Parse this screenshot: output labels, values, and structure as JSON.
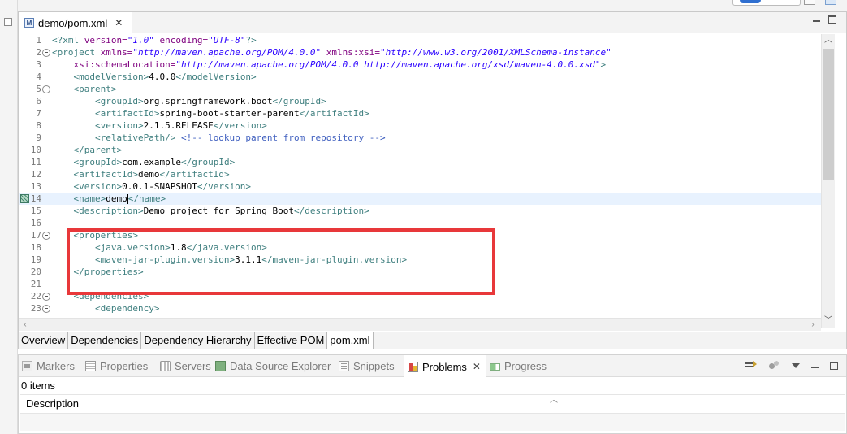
{
  "editor": {
    "tab_title": "demo/pom.xml",
    "tab_icon_letter": "M",
    "close_glyph": "✕",
    "lines": [
      {
        "n": "1",
        "fold": false,
        "current": false,
        "tokens": [
          [
            "pi",
            "<?xml "
          ],
          [
            "attr",
            "version="
          ],
          [
            "str",
            "\"1.0\""
          ],
          [
            "pi",
            " "
          ],
          [
            "attr",
            "encoding="
          ],
          [
            "str",
            "\"UTF-8\""
          ],
          [
            "pi",
            "?>"
          ]
        ]
      },
      {
        "n": "2",
        "fold": true,
        "current": false,
        "tokens": [
          [
            "tag",
            "<project "
          ],
          [
            "attr",
            "xmlns="
          ],
          [
            "str",
            "\"http://maven.apache.org/POM/4.0.0\""
          ],
          [
            "tag",
            " "
          ],
          [
            "attr",
            "xmlns:xsi="
          ],
          [
            "str",
            "\"http://www.w3.org/2001/XMLSchema-instance\""
          ]
        ]
      },
      {
        "n": "3",
        "fold": false,
        "current": false,
        "tokens": [
          [
            "txt",
            "    "
          ],
          [
            "attr",
            "xsi:schemaLocation="
          ],
          [
            "str",
            "\"http://maven.apache.org/POM/4.0.0 http://maven.apache.org/xsd/maven-4.0.0.xsd\""
          ],
          [
            "tag",
            ">"
          ]
        ]
      },
      {
        "n": "4",
        "fold": false,
        "current": false,
        "tokens": [
          [
            "txt",
            "    "
          ],
          [
            "tag",
            "<modelVersion>"
          ],
          [
            "txt",
            "4.0.0"
          ],
          [
            "tag",
            "</modelVersion>"
          ]
        ]
      },
      {
        "n": "5",
        "fold": true,
        "current": false,
        "tokens": [
          [
            "txt",
            "    "
          ],
          [
            "tag",
            "<parent>"
          ]
        ]
      },
      {
        "n": "6",
        "fold": false,
        "current": false,
        "tokens": [
          [
            "txt",
            "        "
          ],
          [
            "tag",
            "<groupId>"
          ],
          [
            "txt",
            "org.springframework.boot"
          ],
          [
            "tag",
            "</groupId>"
          ]
        ]
      },
      {
        "n": "7",
        "fold": false,
        "current": false,
        "tokens": [
          [
            "txt",
            "        "
          ],
          [
            "tag",
            "<artifactId>"
          ],
          [
            "txt",
            "spring-boot-starter-parent"
          ],
          [
            "tag",
            "</artifactId>"
          ]
        ]
      },
      {
        "n": "8",
        "fold": false,
        "current": false,
        "tokens": [
          [
            "txt",
            "        "
          ],
          [
            "tag",
            "<version>"
          ],
          [
            "txt",
            "2.1.5.RELEASE"
          ],
          [
            "tag",
            "</version>"
          ]
        ]
      },
      {
        "n": "9",
        "fold": false,
        "current": false,
        "tokens": [
          [
            "txt",
            "        "
          ],
          [
            "tag",
            "<relativePath/>"
          ],
          [
            "txt",
            " "
          ],
          [
            "cmt",
            "<!-- lookup parent from repository -->"
          ]
        ]
      },
      {
        "n": "10",
        "fold": false,
        "current": false,
        "tokens": [
          [
            "txt",
            "    "
          ],
          [
            "tag",
            "</parent>"
          ]
        ]
      },
      {
        "n": "11",
        "fold": false,
        "current": false,
        "tokens": [
          [
            "txt",
            "    "
          ],
          [
            "tag",
            "<groupId>"
          ],
          [
            "txt",
            "com.example"
          ],
          [
            "tag",
            "</groupId>"
          ]
        ]
      },
      {
        "n": "12",
        "fold": false,
        "current": false,
        "tokens": [
          [
            "txt",
            "    "
          ],
          [
            "tag",
            "<artifactId>"
          ],
          [
            "txt",
            "demo"
          ],
          [
            "tag",
            "</artifactId>"
          ]
        ]
      },
      {
        "n": "13",
        "fold": false,
        "current": false,
        "tokens": [
          [
            "txt",
            "    "
          ],
          [
            "tag",
            "<version>"
          ],
          [
            "txt",
            "0.0.1-SNAPSHOT"
          ],
          [
            "tag",
            "</version>"
          ]
        ]
      },
      {
        "n": "14",
        "fold": false,
        "current": true,
        "tokens": [
          [
            "txt",
            "    "
          ],
          [
            "tag",
            "<name>"
          ],
          [
            "txt",
            "demo"
          ],
          [
            "cursor",
            ""
          ],
          [
            "tag",
            "</name>"
          ]
        ]
      },
      {
        "n": "15",
        "fold": false,
        "current": false,
        "tokens": [
          [
            "txt",
            "    "
          ],
          [
            "tag",
            "<description>"
          ],
          [
            "txt",
            "Demo project for Spring Boot"
          ],
          [
            "tag",
            "</description>"
          ]
        ]
      },
      {
        "n": "16",
        "fold": false,
        "current": false,
        "tokens": []
      },
      {
        "n": "17",
        "fold": true,
        "current": false,
        "tokens": [
          [
            "txt",
            "    "
          ],
          [
            "tag",
            "<properties>"
          ]
        ]
      },
      {
        "n": "18",
        "fold": false,
        "current": false,
        "tokens": [
          [
            "txt",
            "        "
          ],
          [
            "tag",
            "<java.version>"
          ],
          [
            "txt",
            "1.8"
          ],
          [
            "tag",
            "</java.version>"
          ]
        ]
      },
      {
        "n": "19",
        "fold": false,
        "current": false,
        "tokens": [
          [
            "txt",
            "        "
          ],
          [
            "tag",
            "<maven-jar-plugin.version>"
          ],
          [
            "txt",
            "3.1.1"
          ],
          [
            "tag",
            "</maven-jar-plugin.version>"
          ]
        ]
      },
      {
        "n": "20",
        "fold": false,
        "current": false,
        "tokens": [
          [
            "txt",
            "    "
          ],
          [
            "tag",
            "</properties>"
          ]
        ]
      },
      {
        "n": "21",
        "fold": false,
        "current": false,
        "tokens": []
      },
      {
        "n": "22",
        "fold": true,
        "current": false,
        "tokens": [
          [
            "txt",
            "    "
          ],
          [
            "tag",
            "<dependencies>"
          ]
        ]
      },
      {
        "n": "23",
        "fold": true,
        "current": false,
        "tokens": [
          [
            "txt",
            "        "
          ],
          [
            "tag",
            "<dependency>"
          ]
        ]
      }
    ],
    "bottom_tabs": [
      "Overview",
      "Dependencies",
      "Dependency Hierarchy",
      "Effective POM",
      "pom.xml"
    ],
    "active_bottom_tab": "pom.xml",
    "highlight_color": "#e8383a"
  },
  "panel": {
    "tabs": [
      {
        "label": "Markers",
        "icon": "markers-icon",
        "active": false
      },
      {
        "label": "Properties",
        "icon": "properties-icon",
        "active": false
      },
      {
        "label": "Servers",
        "icon": "servers-icon",
        "active": false
      },
      {
        "label": "Data Source Explorer",
        "icon": "data-source-explorer-icon",
        "active": false
      },
      {
        "label": "Snippets",
        "icon": "snippets-icon",
        "active": false
      },
      {
        "label": "Problems",
        "icon": "problems-icon",
        "active": true
      },
      {
        "label": "Progress",
        "icon": "progress-icon",
        "active": false
      }
    ],
    "items_count": "0 items",
    "column_header": "Description"
  }
}
